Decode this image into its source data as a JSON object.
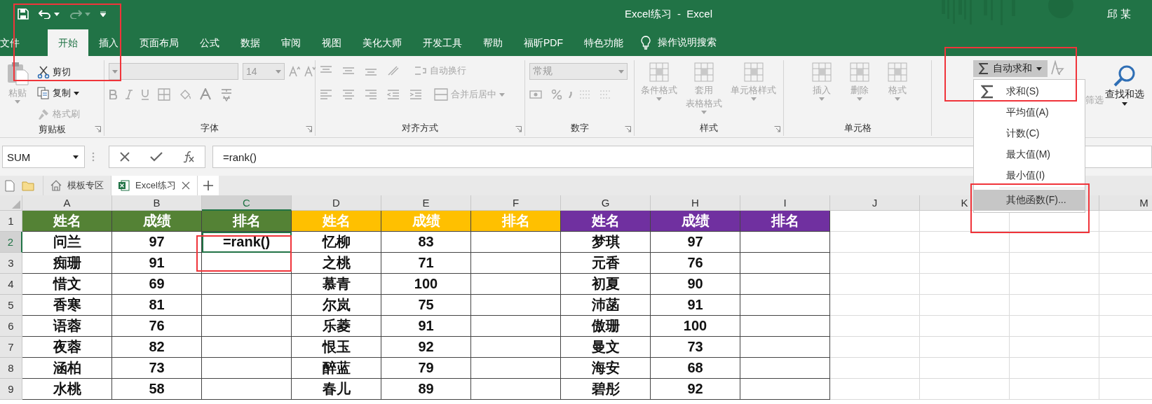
{
  "window": {
    "title": "Excel练习  -  Excel",
    "user": "邱 某"
  },
  "quick_access": {
    "redo_disabled": true
  },
  "ribbon_tabs": [
    {
      "label": "文件",
      "selected": false
    },
    {
      "label": "开始",
      "selected": true
    },
    {
      "label": "插入",
      "selected": false
    },
    {
      "label": "页面布局",
      "selected": false
    },
    {
      "label": "公式",
      "selected": false
    },
    {
      "label": "数据",
      "selected": false
    },
    {
      "label": "审阅",
      "selected": false
    },
    {
      "label": "视图",
      "selected": false
    },
    {
      "label": "美化大师",
      "selected": false
    },
    {
      "label": "开发工具",
      "selected": false
    },
    {
      "label": "帮助",
      "selected": false
    },
    {
      "label": "福昕PDF",
      "selected": false
    },
    {
      "label": "特色功能",
      "selected": false
    }
  ],
  "tell_me": {
    "placeholder": "操作说明搜索"
  },
  "ribbon": {
    "clipboard": {
      "label": "剪贴板",
      "paste": {
        "label": "粘贴",
        "disabled": true
      },
      "cut": {
        "label": "剪切",
        "disabled": false
      },
      "copy": {
        "label": "复制",
        "disabled": false
      },
      "format_painter": {
        "label": "格式刷",
        "disabled": true
      }
    },
    "font": {
      "label": "字体",
      "disabled": true,
      "font_size": "14"
    },
    "alignment": {
      "label": "对齐方式",
      "disabled": true,
      "wrap_text": "自动换行",
      "merge_center": "合并后居中"
    },
    "number": {
      "label": "数字",
      "disabled": true,
      "format": "常规"
    },
    "styles": {
      "label": "样式",
      "disabled": true,
      "items": [
        {
          "lines": [
            "条件格式"
          ]
        },
        {
          "lines": [
            "套用",
            "表格格式"
          ]
        },
        {
          "lines": [
            "单元格样式"
          ]
        }
      ]
    },
    "cells": {
      "label": "单元格",
      "disabled": true,
      "items": [
        "插入",
        "删除",
        "格式"
      ]
    },
    "editing": {
      "autosum": {
        "label": "自动求和",
        "pressed": true
      },
      "sort_filter": {
        "label": "筛选",
        "disabled": true
      },
      "find_select": {
        "label": "查找和选",
        "disabled": false
      }
    }
  },
  "autosum_menu": [
    {
      "kind": "sigma",
      "text": "求和(S)",
      "selected": false
    },
    {
      "kind": "plain",
      "text": "平均值(A)",
      "selected": false
    },
    {
      "kind": "plain",
      "text": "计数(C)",
      "selected": false
    },
    {
      "kind": "plain",
      "text": "最大值(M)",
      "selected": false
    },
    {
      "kind": "plain",
      "text": "最小值(I)",
      "selected": false
    },
    {
      "kind": "plain",
      "text": "其他函数(F)...",
      "selected": true
    }
  ],
  "formula_bar": {
    "name_box": "SUM",
    "formula": "=rank()"
  },
  "doc_tabs": [
    {
      "label": "模板专区",
      "kind": "home",
      "selected": false
    },
    {
      "label": "Excel练习",
      "kind": "excel",
      "selected": true
    }
  ],
  "sheet": {
    "columns": [
      {
        "label": "A",
        "selected": false
      },
      {
        "label": "B",
        "selected": false
      },
      {
        "label": "C",
        "selected": true
      },
      {
        "label": "D",
        "selected": false
      },
      {
        "label": "E",
        "selected": false
      },
      {
        "label": "F",
        "selected": false
      },
      {
        "label": "G",
        "selected": false
      },
      {
        "label": "H",
        "selected": false
      },
      {
        "label": "I",
        "selected": false
      },
      {
        "label": "J",
        "selected": false
      },
      {
        "label": "K",
        "selected": false
      },
      {
        "selected": false
      },
      {
        "label": "M",
        "selected": false
      }
    ],
    "rows": [
      {
        "number": "1",
        "selected": false,
        "cells": [
          {
            "text": "姓名",
            "color": "#548235",
            "selected": false
          },
          {
            "text": "成绩",
            "color": "#548235",
            "selected": false
          },
          {
            "text": "排名",
            "color": "#548235",
            "selected": false
          },
          {
            "text": "姓名",
            "color": "#ffc000",
            "selected": false
          },
          {
            "text": "成绩",
            "color": "#ffc000",
            "selected": false
          },
          {
            "text": "排名",
            "color": "#ffc000",
            "selected": false
          },
          {
            "text": "姓名",
            "color": "#7030a0",
            "selected": false
          },
          {
            "text": "成绩",
            "color": "#7030a0",
            "selected": false
          },
          {
            "text": "排名",
            "color": "#7030a0",
            "selected": false
          }
        ]
      },
      {
        "number": "2",
        "selected": true,
        "cells": [
          {
            "text": "问兰",
            "selected": false
          },
          {
            "text": "97",
            "selected": false
          },
          {
            "text": "=rank()",
            "selected": true
          },
          {
            "text": "忆柳",
            "selected": false
          },
          {
            "text": "83",
            "selected": false
          },
          {
            "selected": false
          },
          {
            "text": "梦琪",
            "selected": false
          },
          {
            "text": "97",
            "selected": false
          },
          {
            "selected": false
          }
        ]
      },
      {
        "number": "3",
        "selected": false,
        "cells": [
          {
            "text": "痴珊",
            "selected": false
          },
          {
            "text": "91",
            "selected": false
          },
          {
            "selected": false
          },
          {
            "text": "之桃",
            "selected": false
          },
          {
            "text": "71",
            "selected": false
          },
          {
            "selected": false
          },
          {
            "text": "元香",
            "selected": false
          },
          {
            "text": "76",
            "selected": false
          },
          {
            "selected": false
          }
        ]
      },
      {
        "number": "4",
        "selected": false,
        "cells": [
          {
            "text": "惜文",
            "selected": false
          },
          {
            "text": "69",
            "selected": false
          },
          {
            "selected": false
          },
          {
            "text": "慕青",
            "selected": false
          },
          {
            "text": "100",
            "selected": false
          },
          {
            "selected": false
          },
          {
            "text": "初夏",
            "selected": false
          },
          {
            "text": "90",
            "selected": false
          },
          {
            "selected": false
          }
        ]
      },
      {
        "number": "5",
        "selected": false,
        "cells": [
          {
            "text": "香寒",
            "selected": false
          },
          {
            "text": "81",
            "selected": false
          },
          {
            "selected": false
          },
          {
            "text": "尔岚",
            "selected": false
          },
          {
            "text": "75",
            "selected": false
          },
          {
            "selected": false
          },
          {
            "text": "沛菡",
            "selected": false
          },
          {
            "text": "91",
            "selected": false
          },
          {
            "selected": false
          }
        ]
      },
      {
        "number": "6",
        "selected": false,
        "cells": [
          {
            "text": "语蓉",
            "selected": false
          },
          {
            "text": "76",
            "selected": false
          },
          {
            "selected": false
          },
          {
            "text": "乐菱",
            "selected": false
          },
          {
            "text": "91",
            "selected": false
          },
          {
            "selected": false
          },
          {
            "text": "傲珊",
            "selected": false
          },
          {
            "text": "100",
            "selected": false
          },
          {
            "selected": false
          }
        ]
      },
      {
        "number": "7",
        "selected": false,
        "cells": [
          {
            "text": "夜蓉",
            "selected": false
          },
          {
            "text": "82",
            "selected": false
          },
          {
            "selected": false
          },
          {
            "text": "恨玉",
            "selected": false
          },
          {
            "text": "92",
            "selected": false
          },
          {
            "selected": false
          },
          {
            "text": "曼文",
            "selected": false
          },
          {
            "text": "73",
            "selected": false
          },
          {
            "selected": false
          }
        ]
      },
      {
        "number": "8",
        "selected": false,
        "cells": [
          {
            "text": "涵柏",
            "selected": false
          },
          {
            "text": "73",
            "selected": false
          },
          {
            "selected": false
          },
          {
            "text": "醉蓝",
            "selected": false
          },
          {
            "text": "79",
            "selected": false
          },
          {
            "selected": false
          },
          {
            "text": "海安",
            "selected": false
          },
          {
            "text": "68",
            "selected": false
          },
          {
            "selected": false
          }
        ]
      },
      {
        "number": "9",
        "selected": false,
        "cells": [
          {
            "text": "水桃",
            "selected": false
          },
          {
            "text": "58",
            "selected": false
          },
          {
            "selected": false
          },
          {
            "text": "春儿",
            "selected": false
          },
          {
            "text": "89",
            "selected": false
          },
          {
            "selected": false
          },
          {
            "text": "碧彤",
            "selected": false
          },
          {
            "text": "92",
            "selected": false
          },
          {
            "selected": false
          }
        ]
      }
    ]
  },
  "annotations": [
    {
      "kind": "quick_access"
    },
    {
      "kind": "active_cell"
    },
    {
      "kind": "autosum"
    },
    {
      "kind": "more_functions"
    }
  ]
}
